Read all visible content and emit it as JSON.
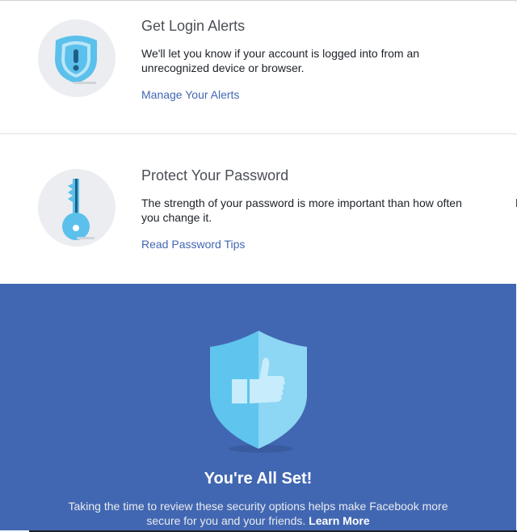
{
  "sections": [
    {
      "icon": "alert-shield-icon",
      "title": "Get Login Alerts",
      "description": "We'll let you know if your account is logged into from an unrecognized device or browser.",
      "link": "Manage Your Alerts"
    },
    {
      "icon": "key-icon",
      "title": "Protect Your Password",
      "description": "The strength of your password is more important than how often you change it.",
      "link": "Read Password Tips"
    }
  ],
  "banner": {
    "icon": "thumbs-up-shield-icon",
    "title": "You're All Set!",
    "text": "Taking the time to review these security options helps make Facebook more secure for you and your friends.",
    "link": "Learn More"
  },
  "colors": {
    "banner_bg": "#4267b2",
    "link": "#4267b2",
    "icon_blue": "#5bc0eb",
    "icon_circle": "#ebedf0"
  }
}
